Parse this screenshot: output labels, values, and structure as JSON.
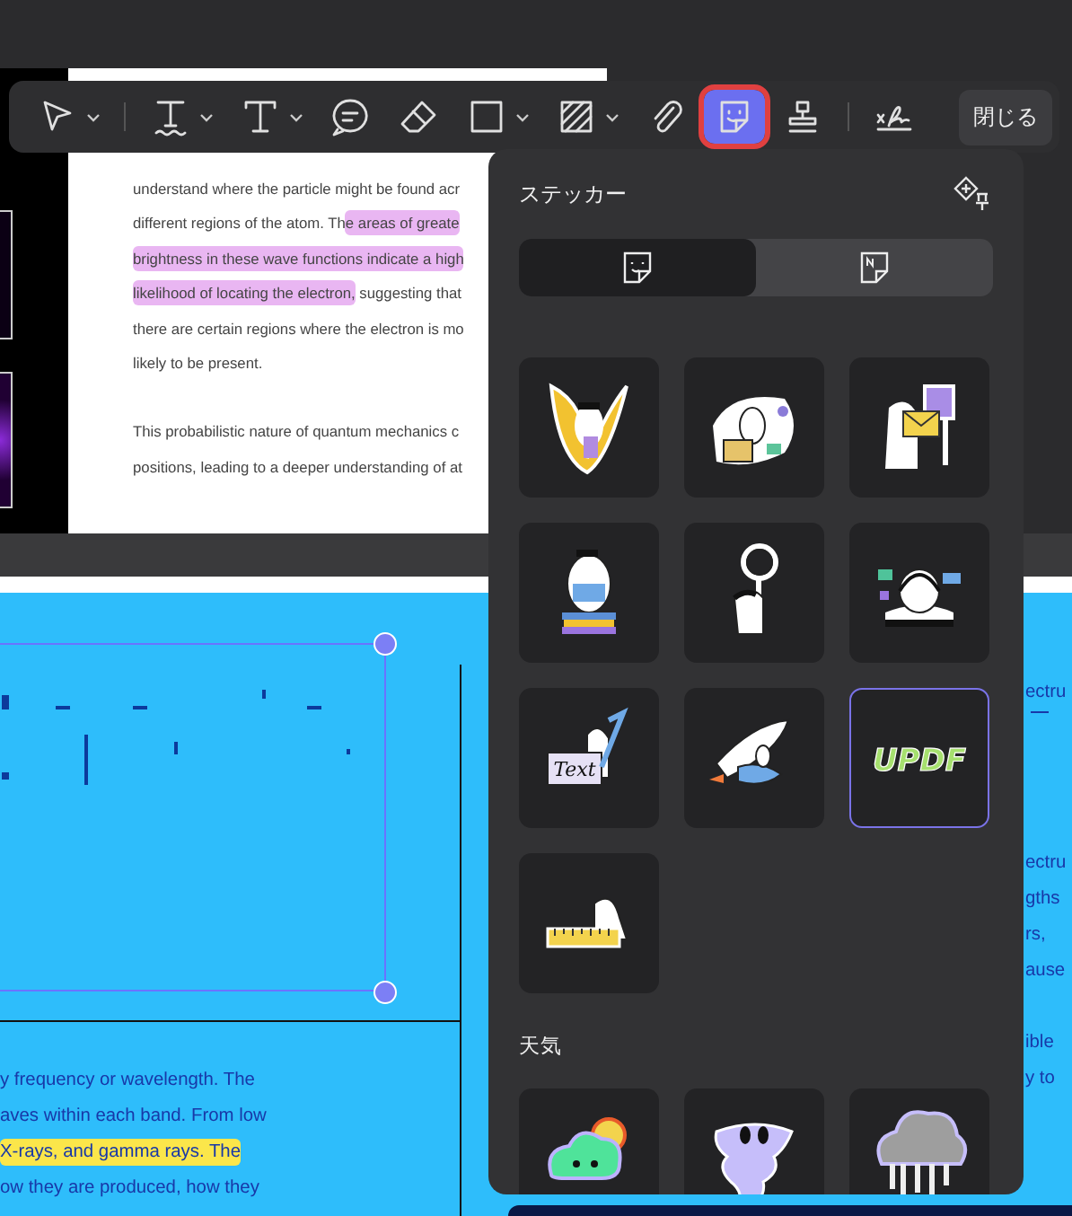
{
  "toolbar": {
    "tools": [
      {
        "kind": "select",
        "has_menu": true,
        "selected": false
      },
      {
        "kind": "text-underline",
        "has_menu": true,
        "selected": false
      },
      {
        "kind": "text",
        "has_menu": true,
        "selected": false
      },
      {
        "kind": "comment",
        "has_menu": false,
        "selected": false
      },
      {
        "kind": "eraser",
        "has_menu": false,
        "selected": false
      },
      {
        "kind": "rectangle",
        "has_menu": true,
        "selected": false
      },
      {
        "kind": "area",
        "has_menu": true,
        "selected": false
      },
      {
        "kind": "attach",
        "has_menu": false,
        "selected": false
      },
      {
        "kind": "sticker",
        "has_menu": false,
        "selected": true
      },
      {
        "kind": "stamp",
        "has_menu": false,
        "selected": false
      },
      {
        "kind": "signature",
        "has_menu": false,
        "selected": false
      }
    ],
    "close_button": "閉じる"
  },
  "document_page": {
    "lines": [
      [
        {
          "text": "understand where the particle might be found acr"
        }
      ],
      [
        {
          "text": "different regions of the atom. Th"
        },
        {
          "text": "e areas of greate",
          "color": "#e9b6f2"
        }
      ],
      [
        {
          "text": "brightness in these wave functions indicate a high",
          "color": "#e9b6f2"
        }
      ],
      [
        {
          "text": "likelihood of locating the electron,",
          "color": "#e9b6f2"
        },
        {
          "text": " suggesting that"
        }
      ],
      [
        {
          "text": "there are certain regions where the electron is mo"
        }
      ],
      [
        {
          "text": "likely to be present."
        }
      ]
    ],
    "lines_2": [
      [
        {
          "text": "This probabilistic nature of quantum mechanics c"
        }
      ],
      [
        {
          "text": "positions, leading to a deeper understanding of at"
        }
      ]
    ]
  },
  "blue_page": {
    "lines": [
      [
        {
          "text": "y frequency or wavelength. The"
        }
      ],
      [
        {
          "text": "aves within each band. From low"
        }
      ],
      [
        {
          "text": "X-rays, and gamma rays. The",
          "color": "#fbe64a"
        }
      ],
      [
        {
          "text": "ow they are produced, how they"
        }
      ]
    ],
    "right_paragraphs": [
      [
        "ectru"
      ],
      [
        "ectru",
        "gths",
        "rs,",
        "ause"
      ],
      [
        "ible",
        "y to"
      ]
    ]
  },
  "sticker_panel": {
    "title": "ステッカー",
    "tabs": [
      {
        "kind": "sticker",
        "selected": true
      },
      {
        "kind": "note",
        "selected": false
      }
    ],
    "sections": [
      {
        "stickers": [
          {
            "kind": "banana",
            "selected": false
          },
          {
            "kind": "shopping",
            "selected": false
          },
          {
            "kind": "mail",
            "selected": false
          },
          {
            "kind": "laptop",
            "selected": false
          },
          {
            "kind": "magnifier",
            "selected": false
          },
          {
            "kind": "headset",
            "selected": false
          },
          {
            "kind": "sign",
            "label": "Text",
            "selected": false
          },
          {
            "kind": "rocket",
            "selected": false
          },
          {
            "kind": "logo",
            "label": "UPDF",
            "selected": true
          },
          {
            "kind": "ruler",
            "selected": false
          }
        ]
      },
      {
        "title": "天気",
        "stickers": [
          {
            "kind": "cloud-sun",
            "selected": false
          },
          {
            "kind": "tornado",
            "selected": false
          },
          {
            "kind": "storm",
            "selected": false
          }
        ]
      }
    ]
  }
}
